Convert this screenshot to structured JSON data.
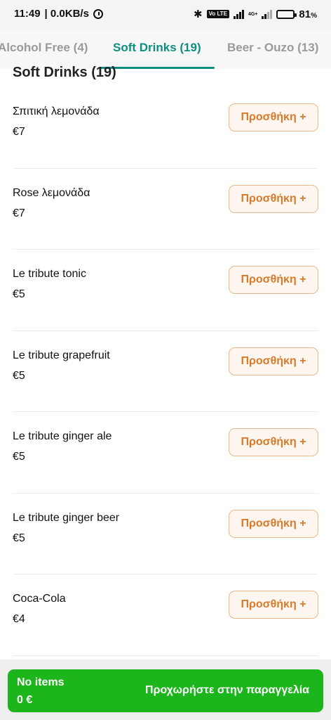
{
  "status_bar": {
    "time": "11:49",
    "network_speed": "| 0.0KB/s",
    "volte_badge": "Vo LTE",
    "network_type": "4G+",
    "battery_percent": "81",
    "battery_percent_sign": "%",
    "battery_level": 0.81
  },
  "tabs": [
    {
      "label": "Alcohol Free (4)",
      "active": false
    },
    {
      "label": "Soft Drinks (19)",
      "active": true
    },
    {
      "label": "Beer - Ouzo (13)",
      "active": false
    }
  ],
  "section_title": "Soft Drinks (19)",
  "add_label": "Προσθήκη +",
  "items": [
    {
      "name": "Σπιτική λεμονάδα",
      "price": "€7"
    },
    {
      "name": "Rose λεμονάδα",
      "price": "€7"
    },
    {
      "name": "Le tribute tonic",
      "price": "€5"
    },
    {
      "name": "Le tribute grapefruit",
      "price": "€5"
    },
    {
      "name": "Le tribute ginger ale",
      "price": "€5"
    },
    {
      "name": "Le tribute ginger beer",
      "price": "€5"
    },
    {
      "name": "Coca-Cola",
      "price": "€4"
    }
  ],
  "cart": {
    "items_label": "No items",
    "total": "0 €",
    "cta_label": "Προχωρήστε στην παραγγελία"
  },
  "colors": {
    "accent_tab": "#0e8e7e",
    "add_button_text": "#d87a2a",
    "add_button_border": "#e9b88a",
    "checkout_bg": "#1cb51c"
  }
}
